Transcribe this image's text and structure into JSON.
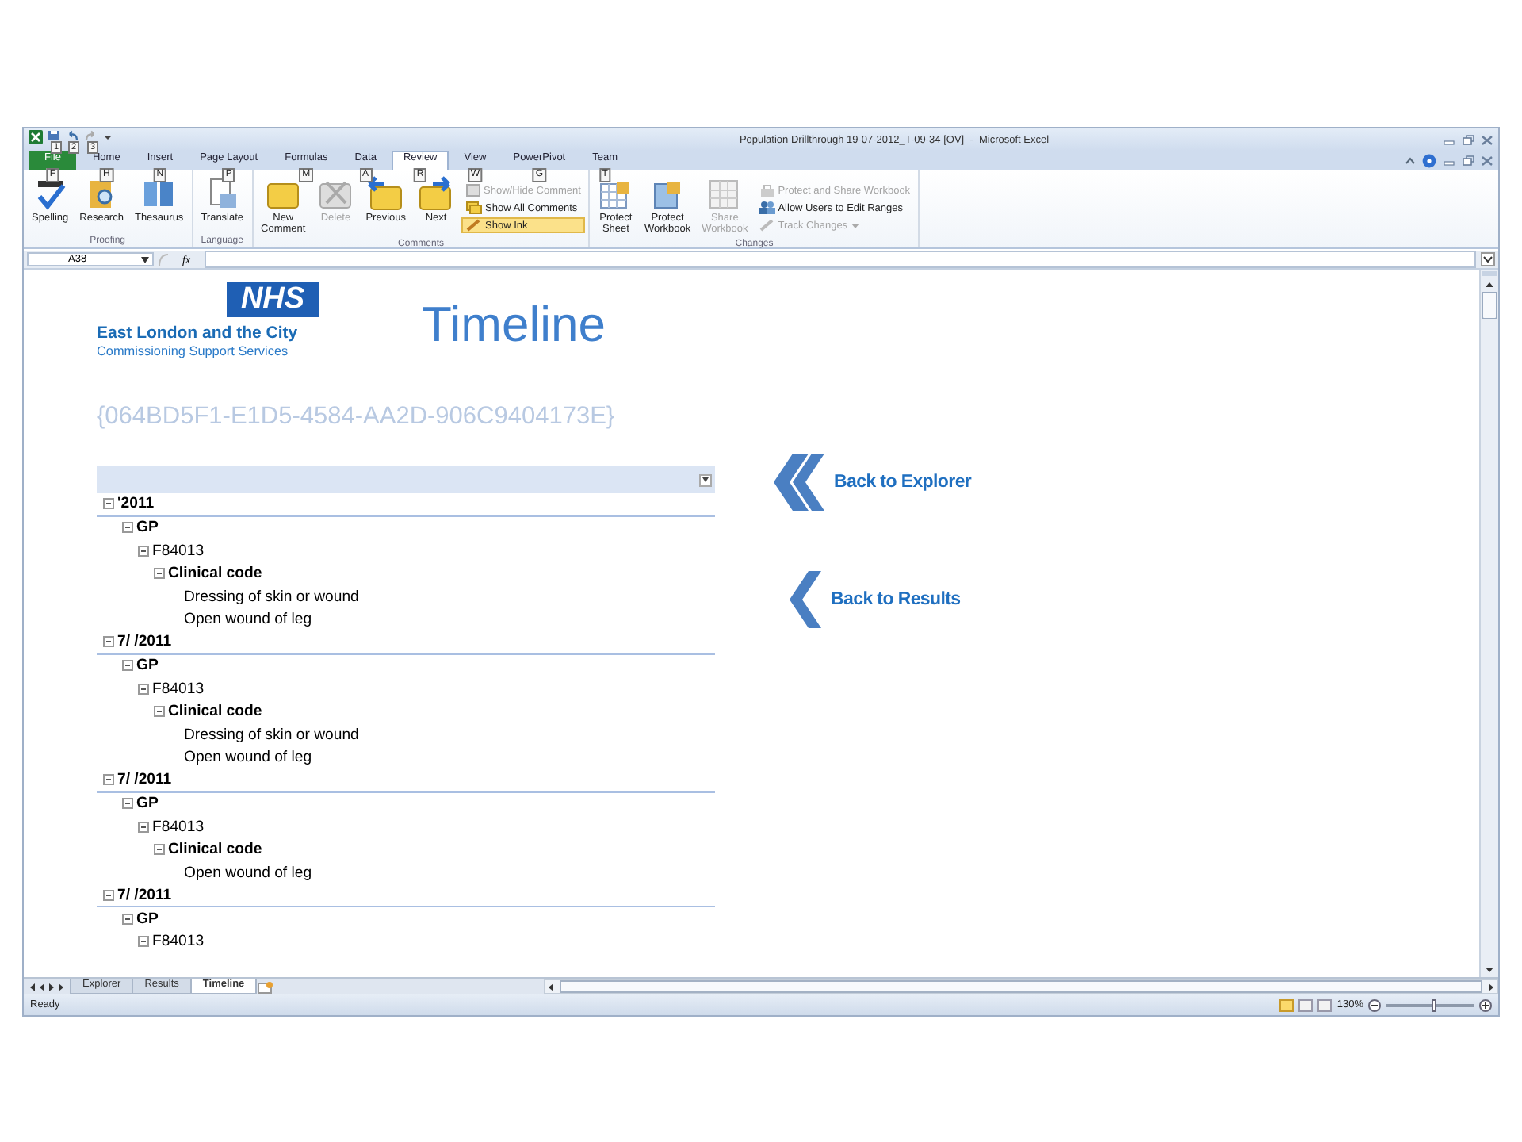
{
  "window": {
    "title": "Population Drillthrough 19-07-2012_T-09-34 [OV]  -  Microsoft Excel",
    "quick_access": [
      {
        "keytip": "1"
      },
      {
        "keytip": "2"
      },
      {
        "keytip": "3"
      }
    ]
  },
  "ribbon_tabs": [
    {
      "label": "File",
      "keytip": "F",
      "selected": false,
      "kind": "backstage"
    },
    {
      "label": "Home",
      "keytip": "H",
      "selected": false,
      "kind": "tab"
    },
    {
      "label": "Insert",
      "keytip": "N",
      "selected": false,
      "kind": "tab"
    },
    {
      "label": "Page Layout",
      "keytip": "P",
      "selected": false,
      "kind": "tab"
    },
    {
      "label": "Formulas",
      "keytip": "M",
      "selected": false,
      "kind": "tab"
    },
    {
      "label": "Data",
      "keytip": "A",
      "selected": false,
      "kind": "tab"
    },
    {
      "label": "Review",
      "keytip": "R",
      "selected": true,
      "kind": "tab"
    },
    {
      "label": "View",
      "keytip": "W",
      "selected": false,
      "kind": "tab"
    },
    {
      "label": "PowerPivot",
      "keytip": "G",
      "selected": false,
      "kind": "tab"
    },
    {
      "label": "Team",
      "keytip": "T",
      "selected": false,
      "kind": "tab"
    }
  ],
  "ribbon_groups": [
    {
      "name": "Proofing",
      "buttons": [
        {
          "kind": "large",
          "label": "Spelling",
          "disabled": false,
          "on": false
        },
        {
          "kind": "large",
          "label": "Research",
          "disabled": false,
          "on": false
        },
        {
          "kind": "large",
          "label": "Thesaurus",
          "disabled": false,
          "on": false
        }
      ]
    },
    {
      "name": "Language",
      "buttons": [
        {
          "kind": "large",
          "label": "Translate",
          "disabled": false,
          "on": false
        }
      ]
    },
    {
      "name": "Comments",
      "buttons": [
        {
          "kind": "large",
          "label": "New Comment",
          "disabled": false,
          "on": false
        },
        {
          "kind": "large",
          "label": "Delete",
          "disabled": true,
          "on": false
        },
        {
          "kind": "large",
          "label": "Previous",
          "disabled": false,
          "on": false
        },
        {
          "kind": "large",
          "label": "Next",
          "disabled": false,
          "on": false
        },
        {
          "kind": "small",
          "label": "Show/Hide Comment",
          "disabled": true,
          "on": false
        },
        {
          "kind": "small",
          "label": "Show All Comments",
          "disabled": false,
          "on": false
        },
        {
          "kind": "small",
          "label": "Show Ink",
          "disabled": false,
          "on": true
        }
      ]
    },
    {
      "name": "Changes",
      "buttons": [
        {
          "kind": "large",
          "label": "Protect Sheet",
          "disabled": false,
          "on": false
        },
        {
          "kind": "large",
          "label": "Protect Workbook",
          "disabled": false,
          "on": false
        },
        {
          "kind": "large",
          "label": "Share Workbook",
          "disabled": true,
          "on": false
        },
        {
          "kind": "small",
          "label": "Protect and Share Workbook",
          "disabled": true,
          "on": false
        },
        {
          "kind": "small",
          "label": "Allow Users to Edit Ranges",
          "disabled": false,
          "on": false
        },
        {
          "kind": "small",
          "label": "Track Changes",
          "disabled": true,
          "on": false
        }
      ]
    }
  ],
  "formula_bar": {
    "name_box": "A38",
    "function_label": "fx"
  },
  "header": {
    "logo": "NHS",
    "org_name": "East London and the City",
    "org_subtitle": "Commissioning Support Services",
    "title": "Timeline",
    "guid": "{064BD5F1-E1D5-4584-AA2D-906C9404173E}"
  },
  "pivot": {
    "rows": [
      {
        "label": "'2011",
        "expanded": true,
        "children": [
          {
            "label": "GP",
            "expanded": true,
            "children": [
              {
                "label": "F84013",
                "expanded": true,
                "children": [
                  {
                    "label": "Clinical code",
                    "expanded": true,
                    "children": [
                      {
                        "label": "Dressing of skin or wound"
                      },
                      {
                        "label": "Open wound of leg"
                      }
                    ]
                  }
                ]
              }
            ]
          }
        ]
      },
      {
        "label": "7/ /2011",
        "expanded": true,
        "children": [
          {
            "label": "GP",
            "expanded": true,
            "children": [
              {
                "label": "F84013",
                "expanded": true,
                "children": [
                  {
                    "label": "Clinical code",
                    "expanded": true,
                    "children": [
                      {
                        "label": "Dressing of skin or wound"
                      },
                      {
                        "label": "Open wound of leg"
                      }
                    ]
                  }
                ]
              }
            ]
          }
        ]
      },
      {
        "label": "7/  /2011",
        "expanded": true,
        "children": [
          {
            "label": "GP",
            "expanded": true,
            "children": [
              {
                "label": "F84013",
                "expanded": true,
                "children": [
                  {
                    "label": "Clinical code",
                    "expanded": true,
                    "children": [
                      {
                        "label": "Open wound of leg"
                      }
                    ]
                  }
                ]
              }
            ]
          }
        ]
      },
      {
        "label": "7/  /2011",
        "expanded": true,
        "children": [
          {
            "label": "GP",
            "expanded": true,
            "children": [
              {
                "label": "F84013",
                "expanded": true
              }
            ]
          }
        ]
      }
    ]
  },
  "links": [
    {
      "kind": "double",
      "label": "Back to Explorer"
    },
    {
      "kind": "single",
      "label": "Back to Results"
    }
  ],
  "sheet_tabs": [
    {
      "label": "Explorer",
      "selected": false
    },
    {
      "label": "Results",
      "selected": false
    },
    {
      "label": "Timeline",
      "selected": true
    }
  ],
  "status_bar": {
    "status": "Ready",
    "views": [
      {
        "selected": true
      },
      {
        "selected": false
      },
      {
        "selected": false
      }
    ],
    "zoom": "130%",
    "zoom_slider": {
      "level": 0.55
    }
  }
}
